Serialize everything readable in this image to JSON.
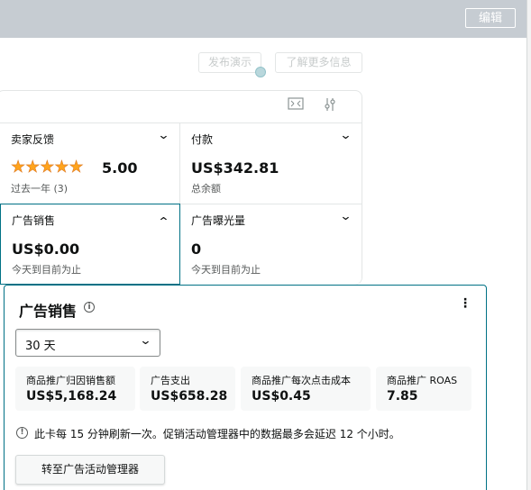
{
  "header": {
    "edit_label": "编辑"
  },
  "toolbar": {
    "demo_label": "发布演示",
    "learn_label": "了解更多信息"
  },
  "widget": {
    "icons": [
      "expand-icon",
      "filter-icon"
    ],
    "tiles": [
      {
        "title": "卖家反馈",
        "stars": "★★★★★",
        "value": "5.00",
        "sub": "过去一年 (3)",
        "expanded": false
      },
      {
        "title": "付款",
        "value": "US$342.81",
        "sub": "总余额",
        "expanded": false
      },
      {
        "title": "广告销售",
        "value": "US$0.00",
        "sub": "今天到目前为止",
        "expanded": true
      },
      {
        "title": "广告曝光量",
        "value": "0",
        "sub": "今天到目前为止",
        "expanded": false
      }
    ]
  },
  "panel": {
    "title": "广告销售",
    "info": "i",
    "menu": "⋮",
    "period": "30 天",
    "metrics": [
      {
        "label": "商品推广归因销售额",
        "value": "US$5,168.24"
      },
      {
        "label": "广告支出",
        "value": "US$658.28"
      },
      {
        "label": "商品推广每次点击成本",
        "value": "US$0.45"
      },
      {
        "label": "商品推广 ROAS",
        "value": "7.85"
      }
    ],
    "notice": "此卡每 15 分钟刷新一次。促销活动管理器中的数据最多会延迟 12 个小时。",
    "goto_label": "转至广告活动管理器"
  },
  "colors": {
    "accent": "#007185",
    "star": "#FFA41C",
    "header_bg": "#C6CCD2"
  }
}
